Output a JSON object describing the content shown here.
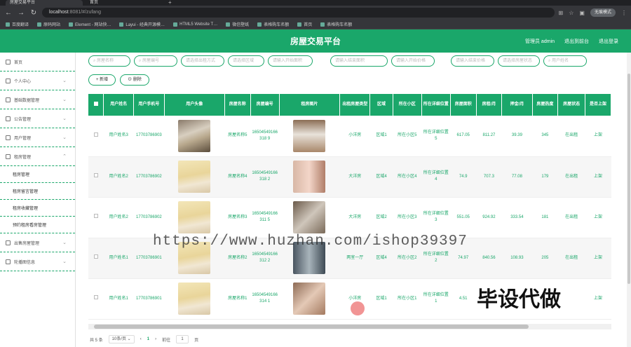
{
  "browser": {
    "tabs": [
      "房屋交易平台",
      "首页"
    ],
    "url_host": "localhost",
    "url_path": ":8081/#/zufang",
    "profile": "无痕模式",
    "bookmarks": [
      "百度翻译",
      "原码网站",
      "Element - 网站快…",
      "Layui - 经典开源模…",
      "HTML5 Website T…",
      "微信壁纸",
      "表格购车名额",
      "首页",
      "表格购车名额"
    ]
  },
  "header": {
    "title": "房屋交易平台",
    "admin": "管理员 admin",
    "logout_front": "退出到前台",
    "logout": "退出登录"
  },
  "sidebar": {
    "items": [
      {
        "label": "首页",
        "icon": "home-icon"
      },
      {
        "label": "个人中心",
        "icon": "user-icon"
      },
      {
        "label": "基础数据管理",
        "icon": "grid-icon"
      },
      {
        "label": "公告管理",
        "icon": "notice-icon"
      },
      {
        "label": "用户管理",
        "icon": "users-icon"
      },
      {
        "label": "租房管理",
        "icon": "house-icon"
      }
    ],
    "subitems": [
      "租房管理",
      "租房留言管理",
      "租房收藏管理",
      "预约租房看房管理"
    ],
    "items2": [
      {
        "label": "出售房屋管理",
        "icon": "list-icon"
      },
      {
        "label": "轮播图信息",
        "icon": "image-icon"
      }
    ]
  },
  "search": {
    "placeholders": [
      "房屋名称",
      "房屋编号",
      "请选择出租方式",
      "请选择区域",
      "请输入开始面积",
      "请输入结束面积",
      "请输入开始价格",
      "请输入结束价格",
      "请选择房屋状态",
      "用户姓名"
    ]
  },
  "buttons": {
    "add": "+ 新增",
    "delete": "删除"
  },
  "table": {
    "headers": [
      "用户姓名",
      "用户手机号",
      "用户头像",
      "房屋名称",
      "房屋编号",
      "租房图片",
      "出租房屋类型",
      "区域",
      "所在小区",
      "所在详细位置",
      "房屋面积",
      "房租/月",
      "押金/月",
      "房屋热度",
      "房屋状态",
      "是否上架"
    ],
    "rows": [
      {
        "name": "用户姓名3",
        "phone": "17703786903",
        "avatar": "cat",
        "house": "房屋名称5",
        "code": "16504549166318 9",
        "img": "r1",
        "type": "小洋房",
        "area": "区域1",
        "community": "所在小区5",
        "addr": "所在详细位置5",
        "size": "617.05",
        "rent": "811.27",
        "deposit": "39.39",
        "heat": "345",
        "status": "在出租",
        "shelf": "上架"
      },
      {
        "name": "用户姓名2",
        "phone": "17703786902",
        "avatar": "girl",
        "house": "房屋名称4",
        "code": "16504549166318 2",
        "img": "r2",
        "type": "大洋房",
        "area": "区域4",
        "community": "所在小区4",
        "addr": "所在详细位置4",
        "size": "74.9",
        "rent": "707.3",
        "deposit": "77.08",
        "heat": "179",
        "status": "在出租",
        "shelf": "上架"
      },
      {
        "name": "用户姓名2",
        "phone": "17703786902",
        "avatar": "girl",
        "house": "房屋名称3",
        "code": "16504549166311 5",
        "img": "r3",
        "type": "大洋房",
        "area": "区域2",
        "community": "所在小区3",
        "addr": "所在详细位置3",
        "size": "551.05",
        "rent": "924.92",
        "deposit": "333.54",
        "heat": "181",
        "status": "在出租",
        "shelf": "上架"
      },
      {
        "name": "用户姓名1",
        "phone": "17703786901",
        "avatar": "girl",
        "house": "房屋名称2",
        "code": "16504549166312 2",
        "img": "r4",
        "type": "两室一厅",
        "area": "区域4",
        "community": "所在小区2",
        "addr": "所在详细位置2",
        "size": "74.97",
        "rent": "840.56",
        "deposit": "108.93",
        "heat": "205",
        "status": "在出租",
        "shelf": "上架"
      },
      {
        "name": "用户姓名1",
        "phone": "17703786901",
        "avatar": "girl",
        "house": "房屋名称1",
        "code": "16504549166314 1",
        "img": "r5",
        "type": "小洋房",
        "area": "区域1",
        "community": "所在小区1",
        "addr": "所在详细位置1",
        "size": "4.51",
        "rent": "",
        "deposit": "",
        "heat": "",
        "status": "",
        "shelf": "上架"
      }
    ]
  },
  "pagination": {
    "total": "共 5 条",
    "page_size": "10条/页",
    "current": "1",
    "goto_label": "前往",
    "goto_value": "1",
    "page_unit": "页"
  },
  "overlay": {
    "watermark": "https://www.huzhan.com/ishop39397",
    "big_text": "毕设代做"
  },
  "colors": {
    "accent": "#1aa76a"
  }
}
